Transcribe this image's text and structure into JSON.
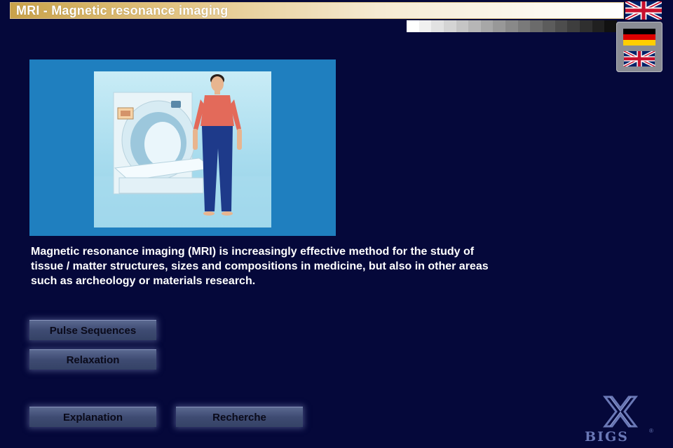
{
  "header": {
    "title": "MRI - Magnetic resonance imaging"
  },
  "language": {
    "current": "uk-flag-icon",
    "options": [
      "german-flag-icon",
      "uk-flag-icon"
    ]
  },
  "description": {
    "line1": "Magnetic resonance imaging (MRI) is increasingly effective method for the study of",
    "line2": "tissue / matter structures, sizes and compositions in medicine, but also in other areas",
    "line3": "such as archeology or materials research."
  },
  "buttons": {
    "pulse_sequences": "Pulse Sequences",
    "relaxation": "Relaxation",
    "explanation": "Explanation",
    "recherche": "Recherche"
  },
  "logo": {
    "text": "BIGS",
    "registered": "®"
  },
  "colors": {
    "background": "#05083a",
    "accent_gold": "#c9a24a",
    "button": "#3e4b72",
    "logo": "#6a78b6"
  }
}
